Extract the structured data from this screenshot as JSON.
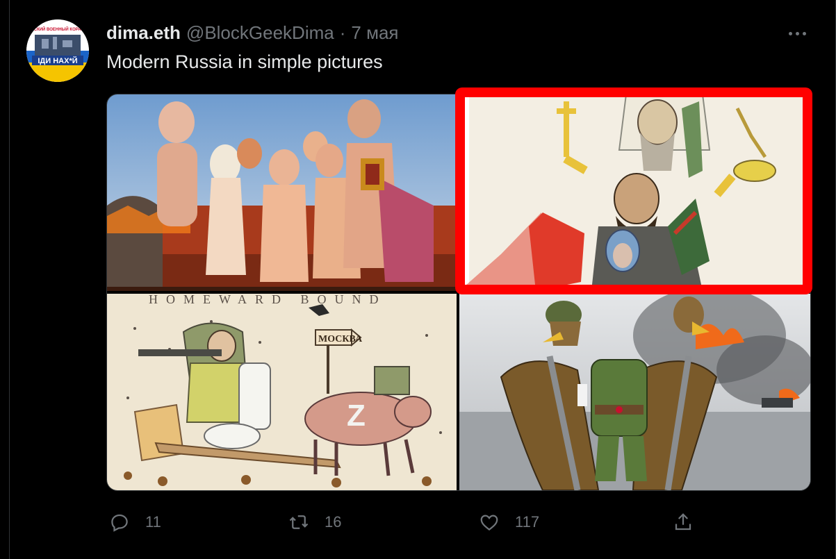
{
  "tweet": {
    "display_name": "dima.eth",
    "handle": "@BlockGeekDima",
    "separator": "·",
    "time": "7 мая",
    "text": "Modern Russia in simple pictures",
    "avatar_text_top": "РУССКИЙ ВОЕННЫЙ КОРАБЛЬ",
    "avatar_text_bottom": "ІДИ НАХ*Й"
  },
  "media": {
    "tile3_title": "HOMEWARD BOUND",
    "tile3_sign": "МОСКВА",
    "tile3_letter": "Z",
    "highlight_color": "#ff0000"
  },
  "actions": {
    "reply_count": "11",
    "retweet_count": "16",
    "like_count": "117"
  },
  "icons": [
    "reply-icon",
    "retweet-icon",
    "like-icon",
    "share-icon",
    "more-icon"
  ]
}
